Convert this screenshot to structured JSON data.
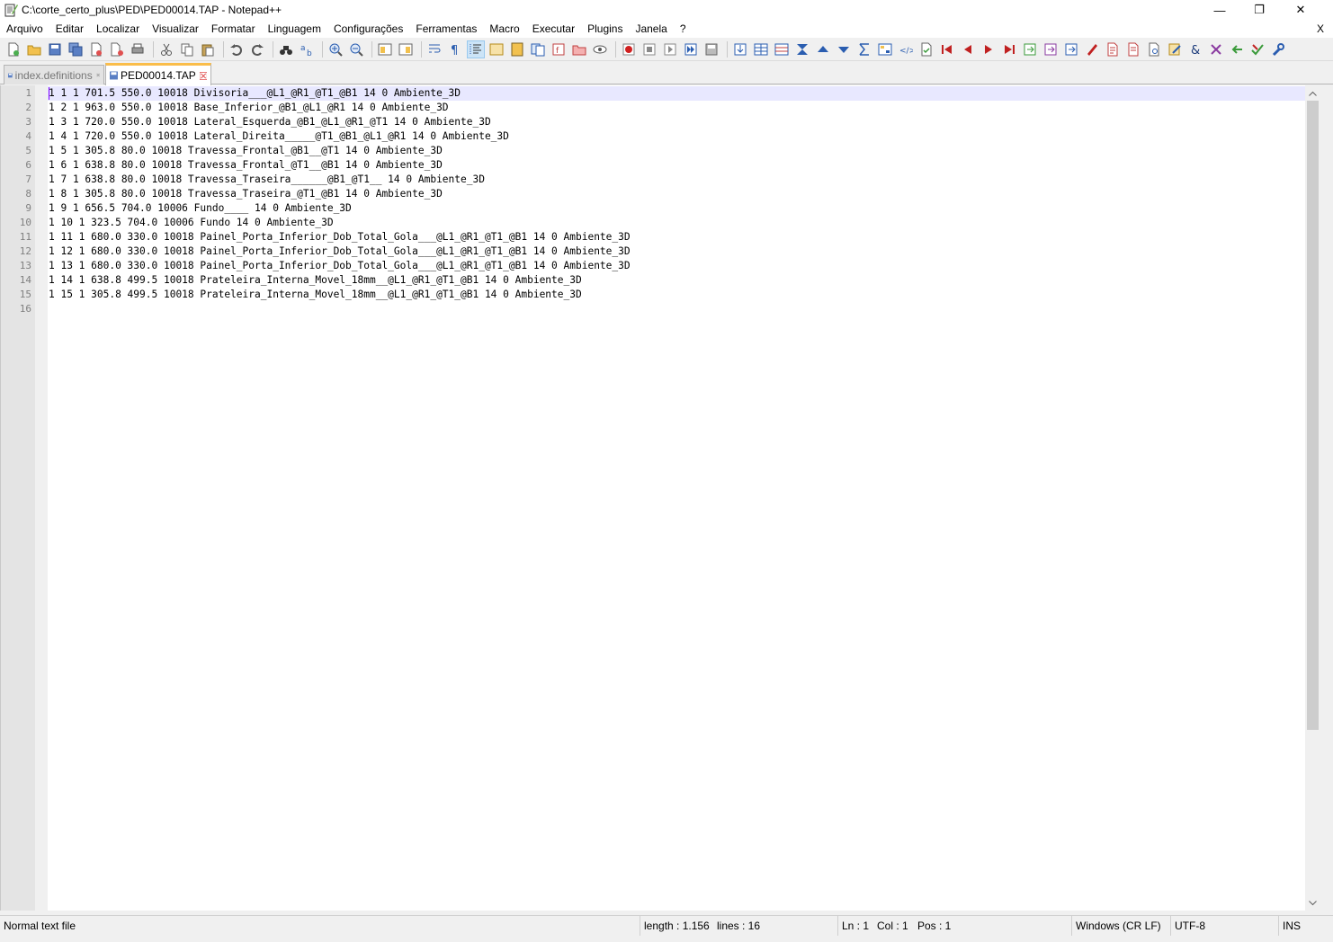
{
  "window": {
    "title": "C:\\corte_certo_plus\\PED\\PED00014.TAP - Notepad++",
    "minimize": "—",
    "restore": "❐",
    "close": "✕"
  },
  "menu": {
    "items": [
      "Arquivo",
      "Editar",
      "Localizar",
      "Visualizar",
      "Formatar",
      "Linguagem",
      "Configurações",
      "Ferramentas",
      "Macro",
      "Executar",
      "Plugins",
      "Janela",
      "?"
    ],
    "close_doc": "X"
  },
  "tabs": [
    {
      "label": "index.definitions",
      "active": false
    },
    {
      "label": "PED00014.TAP",
      "active": true
    }
  ],
  "editor": {
    "lines": [
      "1 1 1 701.5 550.0 10018 Divisoria___@L1_@R1_@T1_@B1 14 0 Ambiente_3D",
      "1 2 1 963.0 550.0 10018 Base_Inferior_@B1_@L1_@R1 14 0 Ambiente_3D",
      "1 3 1 720.0 550.0 10018 Lateral_Esquerda_@B1_@L1_@R1_@T1 14 0 Ambiente_3D",
      "1 4 1 720.0 550.0 10018 Lateral_Direita_____@T1_@B1_@L1_@R1 14 0 Ambiente_3D",
      "1 5 1 305.8 80.0 10018 Travessa_Frontal_@B1__@T1 14 0 Ambiente_3D",
      "1 6 1 638.8 80.0 10018 Travessa_Frontal_@T1__@B1 14 0 Ambiente_3D",
      "1 7 1 638.8 80.0 10018 Travessa_Traseira______@B1_@T1__ 14 0 Ambiente_3D",
      "1 8 1 305.8 80.0 10018 Travessa_Traseira_@T1_@B1 14 0 Ambiente_3D",
      "1 9 1 656.5 704.0 10006 Fundo____ 14 0 Ambiente_3D",
      "1 10 1 323.5 704.0 10006 Fundo 14 0 Ambiente_3D",
      "1 11 1 680.0 330.0 10018 Painel_Porta_Inferior_Dob_Total_Gola___@L1_@R1_@T1_@B1 14 0 Ambiente_3D",
      "1 12 1 680.0 330.0 10018 Painel_Porta_Inferior_Dob_Total_Gola___@L1_@R1_@T1_@B1 14 0 Ambiente_3D",
      "1 13 1 680.0 330.0 10018 Painel_Porta_Inferior_Dob_Total_Gola___@L1_@R1_@T1_@B1 14 0 Ambiente_3D",
      "1 14 1 638.8 499.5 10018 Prateleira_Interna_Movel_18mm__@L1_@R1_@T1_@B1 14 0 Ambiente_3D",
      "1 15 1 305.8 499.5 10018 Prateleira_Interna_Movel_18mm__@L1_@R1_@T1_@B1 14 0 Ambiente_3D",
      ""
    ]
  },
  "status": {
    "file_type": "Normal text file",
    "length": "length : 1.156",
    "lines": "lines : 16",
    "ln": "Ln : 1",
    "col": "Col : 1",
    "pos": "Pos : 1",
    "eol": "Windows (CR LF)",
    "encoding": "UTF-8",
    "mode": "INS"
  },
  "colors": {
    "active_tab_accent": "#fabd4a",
    "current_line": "#e8e8ff",
    "gutter": "#e4e4e4"
  }
}
